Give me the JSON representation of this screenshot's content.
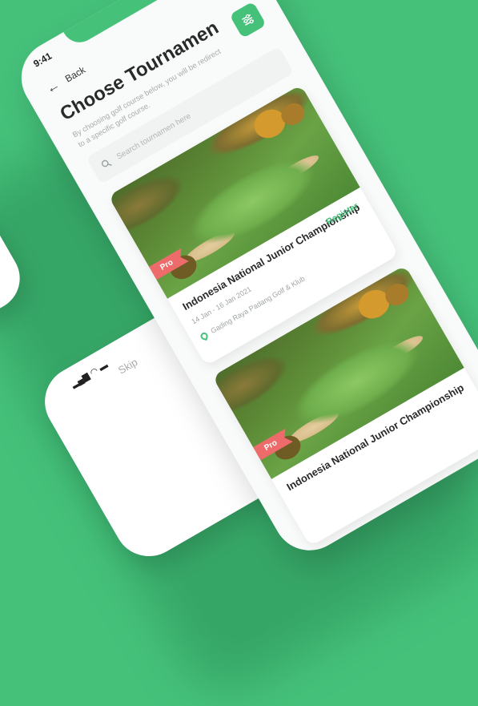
{
  "colors": {
    "brand": "#45c17a",
    "pro_badge": "#ee6b6b"
  },
  "status_bar": {
    "time": "9:41"
  },
  "nav": {
    "back_label": "Back",
    "back_icon": "arrow-left-icon"
  },
  "header": {
    "title": "Choose Tournamen",
    "subtitle": "By choosing golf course below, you will be redirect to a specific golf course.",
    "filter_icon": "sliders-icon"
  },
  "search": {
    "placeholder": "Search tournamen here",
    "icon": "search-icon"
  },
  "tournaments": [
    {
      "badge": "Pro",
      "title": "Indonesia National Junior Championship",
      "dates": "14 Jan - 16 Jan 2021",
      "location": "Gading Raya Padang Golf & Klub",
      "action": "Register"
    },
    {
      "badge": "Pro",
      "title": "Indonesia National Junior Championship"
    }
  ],
  "secondary_phone": {
    "skip_label": "Skip"
  }
}
